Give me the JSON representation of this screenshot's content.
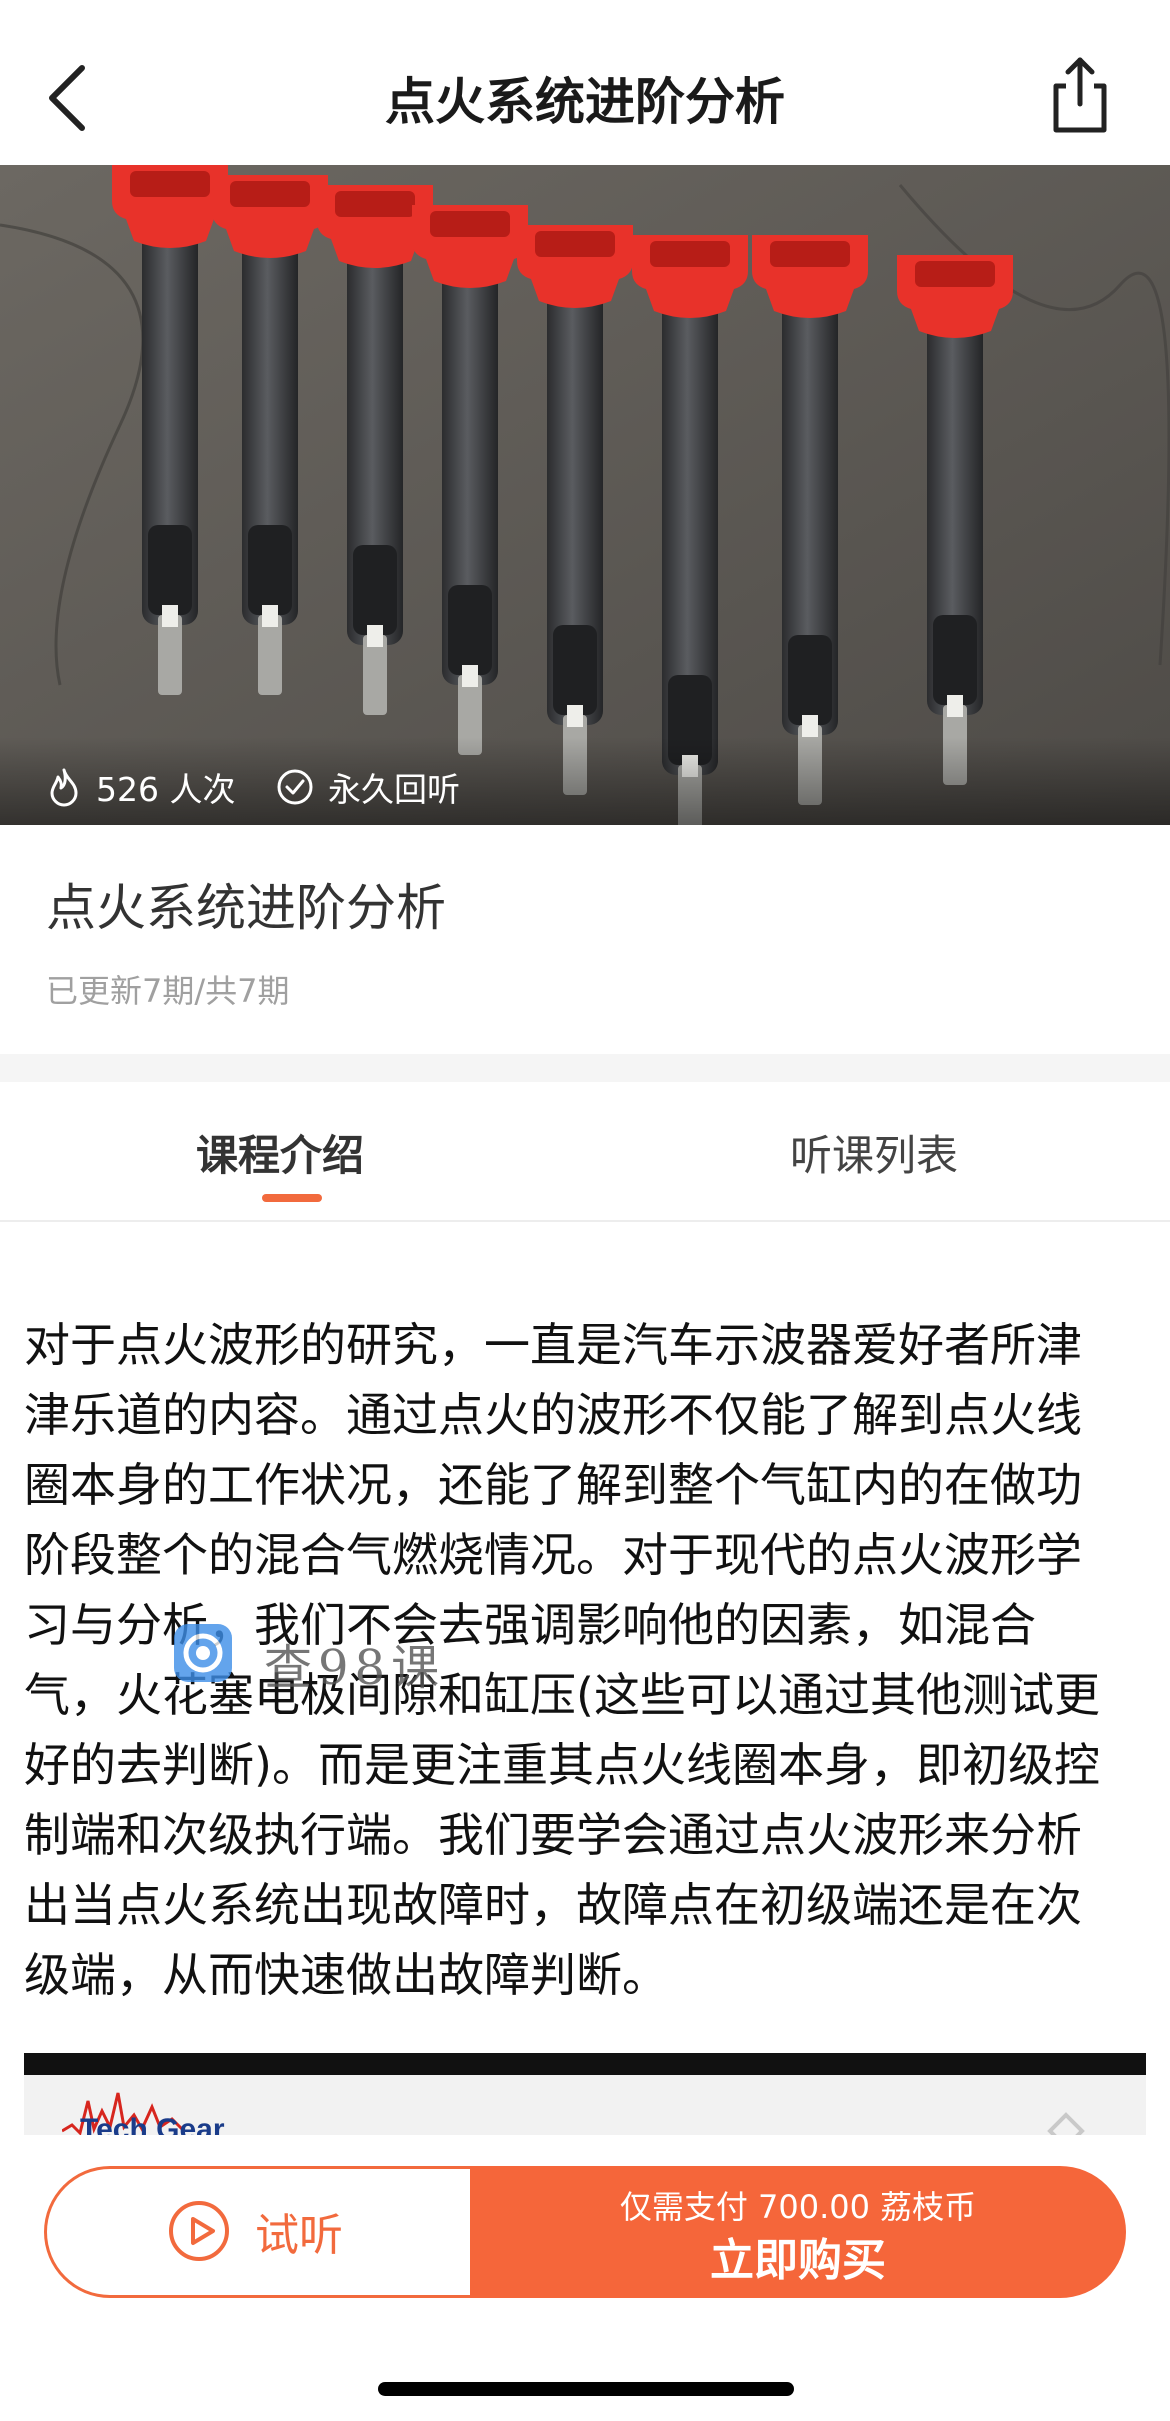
{
  "header": {
    "title": "点火系统进阶分析",
    "back_icon": "chevron-left-icon",
    "share_icon": "share-icon"
  },
  "cover": {
    "views": "526 人次",
    "lifetime": "永久回听",
    "views_icon": "flame-icon",
    "lifetime_icon": "check-circle-icon"
  },
  "course": {
    "title": "点火系统进阶分析",
    "updates": "已更新7期/共7期"
  },
  "tabs": [
    {
      "label": "课程介绍",
      "active": true
    },
    {
      "label": "听课列表",
      "active": false
    }
  ],
  "intro": {
    "lines": [
      "对于点火波形的研究，一直是汽车示波器爱好者所津",
      "津乐道的内容。通过点火的波形不仅能了解到点火线",
      "圈本身的工作状况，还能了解到整个气缸内的在做功",
      "阶段整个的混合气燃烧情况。对于现代的点火波形学",
      "习与分析，我们不会去强调影响他的因素，如混合",
      "气，火花塞电极间隙和缸压(这些可以通过其他测试更",
      "好的去判断)。而是更注重其点火线圈本身，即初级控",
      "制端和次级执行端。我们要学会通过点火波形来分析",
      "出当点火系统出现故障时，故障点在初级端还是在次",
      "级端，从而快速做出故障判断。"
    ]
  },
  "watermark": {
    "text": "查98课"
  },
  "preview": {
    "brand": "Tech Gear"
  },
  "bottom_bar": {
    "trial_label": "试听",
    "trial_icon": "play-circle-icon",
    "price_text": "仅需支付 700.00 荔枝币",
    "buy_label": "立即购买"
  },
  "colors": {
    "accent": "#f26a3d",
    "buy_button": "#f5663a",
    "coil_red": "#e8322a"
  }
}
